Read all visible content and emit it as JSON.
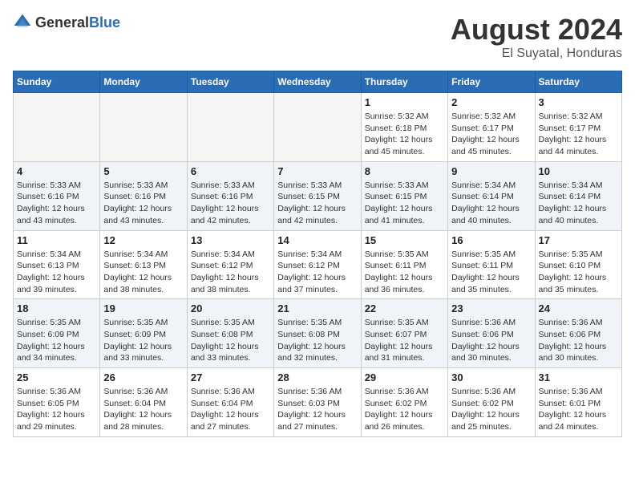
{
  "logo": {
    "text_general": "General",
    "text_blue": "Blue"
  },
  "title": {
    "month_year": "August 2024",
    "location": "El Suyatal, Honduras"
  },
  "days_header": [
    "Sunday",
    "Monday",
    "Tuesday",
    "Wednesday",
    "Thursday",
    "Friday",
    "Saturday"
  ],
  "weeks": [
    [
      {
        "day": "",
        "info": ""
      },
      {
        "day": "",
        "info": ""
      },
      {
        "day": "",
        "info": ""
      },
      {
        "day": "",
        "info": ""
      },
      {
        "day": "1",
        "info": "Sunrise: 5:32 AM\nSunset: 6:18 PM\nDaylight: 12 hours and 45 minutes."
      },
      {
        "day": "2",
        "info": "Sunrise: 5:32 AM\nSunset: 6:17 PM\nDaylight: 12 hours and 45 minutes."
      },
      {
        "day": "3",
        "info": "Sunrise: 5:32 AM\nSunset: 6:17 PM\nDaylight: 12 hours and 44 minutes."
      }
    ],
    [
      {
        "day": "4",
        "info": "Sunrise: 5:33 AM\nSunset: 6:16 PM\nDaylight: 12 hours and 43 minutes."
      },
      {
        "day": "5",
        "info": "Sunrise: 5:33 AM\nSunset: 6:16 PM\nDaylight: 12 hours and 43 minutes."
      },
      {
        "day": "6",
        "info": "Sunrise: 5:33 AM\nSunset: 6:16 PM\nDaylight: 12 hours and 42 minutes."
      },
      {
        "day": "7",
        "info": "Sunrise: 5:33 AM\nSunset: 6:15 PM\nDaylight: 12 hours and 42 minutes."
      },
      {
        "day": "8",
        "info": "Sunrise: 5:33 AM\nSunset: 6:15 PM\nDaylight: 12 hours and 41 minutes."
      },
      {
        "day": "9",
        "info": "Sunrise: 5:34 AM\nSunset: 6:14 PM\nDaylight: 12 hours and 40 minutes."
      },
      {
        "day": "10",
        "info": "Sunrise: 5:34 AM\nSunset: 6:14 PM\nDaylight: 12 hours and 40 minutes."
      }
    ],
    [
      {
        "day": "11",
        "info": "Sunrise: 5:34 AM\nSunset: 6:13 PM\nDaylight: 12 hours and 39 minutes."
      },
      {
        "day": "12",
        "info": "Sunrise: 5:34 AM\nSunset: 6:13 PM\nDaylight: 12 hours and 38 minutes."
      },
      {
        "day": "13",
        "info": "Sunrise: 5:34 AM\nSunset: 6:12 PM\nDaylight: 12 hours and 38 minutes."
      },
      {
        "day": "14",
        "info": "Sunrise: 5:34 AM\nSunset: 6:12 PM\nDaylight: 12 hours and 37 minutes."
      },
      {
        "day": "15",
        "info": "Sunrise: 5:35 AM\nSunset: 6:11 PM\nDaylight: 12 hours and 36 minutes."
      },
      {
        "day": "16",
        "info": "Sunrise: 5:35 AM\nSunset: 6:11 PM\nDaylight: 12 hours and 35 minutes."
      },
      {
        "day": "17",
        "info": "Sunrise: 5:35 AM\nSunset: 6:10 PM\nDaylight: 12 hours and 35 minutes."
      }
    ],
    [
      {
        "day": "18",
        "info": "Sunrise: 5:35 AM\nSunset: 6:09 PM\nDaylight: 12 hours and 34 minutes."
      },
      {
        "day": "19",
        "info": "Sunrise: 5:35 AM\nSunset: 6:09 PM\nDaylight: 12 hours and 33 minutes."
      },
      {
        "day": "20",
        "info": "Sunrise: 5:35 AM\nSunset: 6:08 PM\nDaylight: 12 hours and 33 minutes."
      },
      {
        "day": "21",
        "info": "Sunrise: 5:35 AM\nSunset: 6:08 PM\nDaylight: 12 hours and 32 minutes."
      },
      {
        "day": "22",
        "info": "Sunrise: 5:35 AM\nSunset: 6:07 PM\nDaylight: 12 hours and 31 minutes."
      },
      {
        "day": "23",
        "info": "Sunrise: 5:36 AM\nSunset: 6:06 PM\nDaylight: 12 hours and 30 minutes."
      },
      {
        "day": "24",
        "info": "Sunrise: 5:36 AM\nSunset: 6:06 PM\nDaylight: 12 hours and 30 minutes."
      }
    ],
    [
      {
        "day": "25",
        "info": "Sunrise: 5:36 AM\nSunset: 6:05 PM\nDaylight: 12 hours and 29 minutes."
      },
      {
        "day": "26",
        "info": "Sunrise: 5:36 AM\nSunset: 6:04 PM\nDaylight: 12 hours and 28 minutes."
      },
      {
        "day": "27",
        "info": "Sunrise: 5:36 AM\nSunset: 6:04 PM\nDaylight: 12 hours and 27 minutes."
      },
      {
        "day": "28",
        "info": "Sunrise: 5:36 AM\nSunset: 6:03 PM\nDaylight: 12 hours and 27 minutes."
      },
      {
        "day": "29",
        "info": "Sunrise: 5:36 AM\nSunset: 6:02 PM\nDaylight: 12 hours and 26 minutes."
      },
      {
        "day": "30",
        "info": "Sunrise: 5:36 AM\nSunset: 6:02 PM\nDaylight: 12 hours and 25 minutes."
      },
      {
        "day": "31",
        "info": "Sunrise: 5:36 AM\nSunset: 6:01 PM\nDaylight: 12 hours and 24 minutes."
      }
    ]
  ]
}
